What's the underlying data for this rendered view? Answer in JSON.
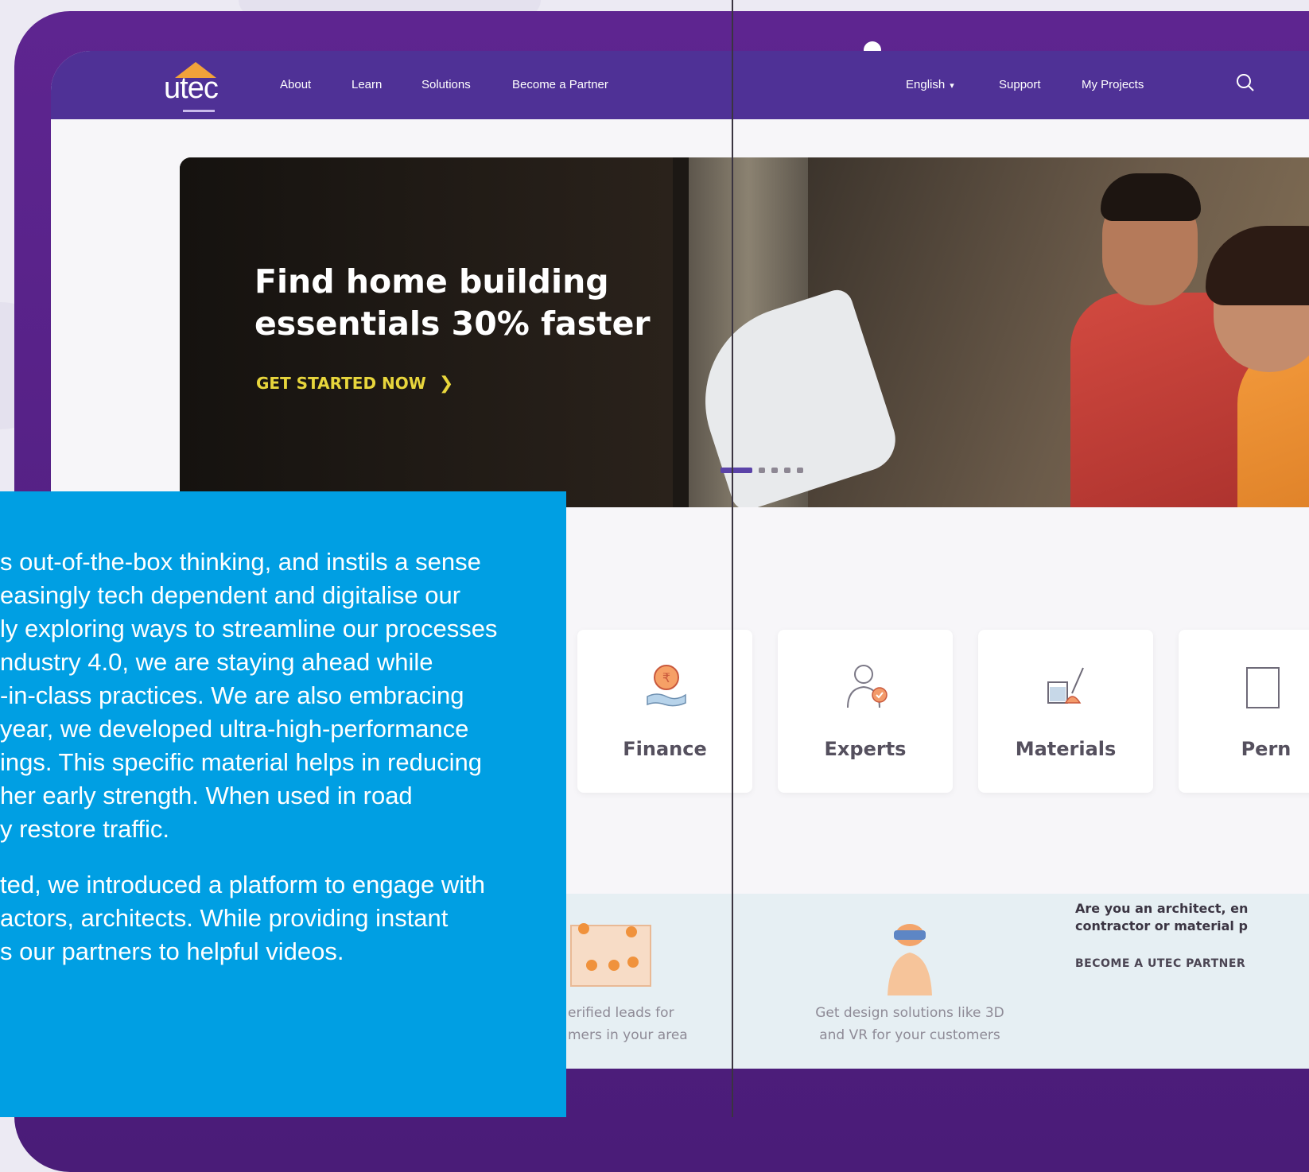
{
  "nav": {
    "logo": "utec",
    "links": [
      "About",
      "Learn",
      "Solutions",
      "Become a Partner"
    ],
    "language": "English",
    "support": "Support",
    "my_projects": "My Projects"
  },
  "hero": {
    "title_line1": "Find home building",
    "title_line2": "essentials 30% faster",
    "cta": "GET STARTED NOW"
  },
  "categories": [
    "Finance",
    "Experts",
    "Materials",
    "Pern"
  ],
  "strip": {
    "leads_line1": "erified leads for",
    "leads_line2": "mers in your area",
    "design_line1": "Get design solutions like 3D",
    "design_line2": "and VR for your customers",
    "partner_q_line1": "Are you an architect, en",
    "partner_q_line2": "contractor or material p",
    "partner_cta": "BECOME A UTEC PARTNER"
  },
  "overlay_text": {
    "p1": [
      "s out-of-the-box thinking, and instils a sense",
      "easingly tech dependent and digitalise our",
      "ly exploring ways to streamline our processes",
      "ndustry 4.0, we are staying ahead while",
      "-in-class practices. We are also embracing",
      "year, we developed ultra-high-performance",
      "ings. This specific material helps in reducing",
      "her early strength. When used in road",
      "y restore traffic."
    ],
    "p2": [
      "ted, we introduced a platform to engage with",
      "actors, architects. While providing instant",
      "s our partners to helpful videos."
    ]
  },
  "colors": {
    "laptop_frame": "#5e2590",
    "nav_bg": "#4f3196",
    "overlay_bg": "#009fe3",
    "cta_yellow": "#e8d63c",
    "logo_roof": "#f2a23a"
  }
}
